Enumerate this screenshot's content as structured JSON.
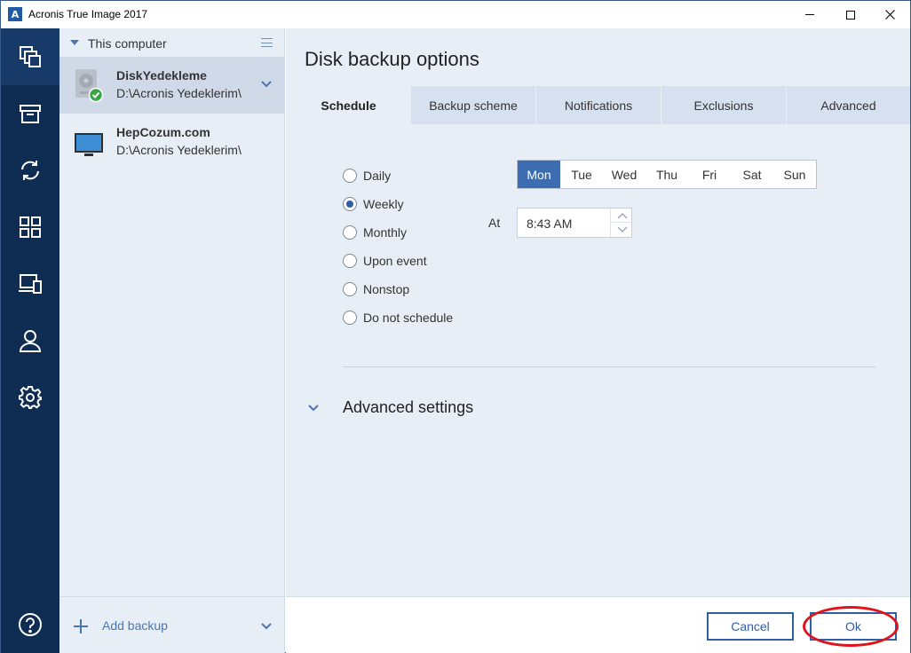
{
  "window": {
    "logo_letter": "A",
    "title": "Acronis True Image 2017"
  },
  "rail": {
    "items": [
      {
        "name": "backup",
        "icon": "backup-copies-icon",
        "active": true
      },
      {
        "name": "archive",
        "icon": "archive-box-icon"
      },
      {
        "name": "sync",
        "icon": "sync-icon"
      },
      {
        "name": "tools",
        "icon": "tools-grid-icon"
      },
      {
        "name": "devices",
        "icon": "devices-icon"
      },
      {
        "name": "account",
        "icon": "account-icon"
      },
      {
        "name": "settings",
        "icon": "gear-icon"
      },
      {
        "name": "help",
        "icon": "help-icon"
      }
    ]
  },
  "backups": {
    "header": "This computer",
    "items": [
      {
        "name": "DiskYedekleme",
        "path": "D:\\Acronis Yedeklerim\\",
        "icon": "disk-ok-icon",
        "selected": true
      },
      {
        "name": "HepCozum.com",
        "path": "D:\\Acronis Yedeklerim\\",
        "icon": "monitor-icon",
        "selected": false
      }
    ],
    "add_label": "Add backup"
  },
  "main": {
    "title": "Disk backup options",
    "tabs": [
      {
        "label": "Schedule",
        "active": true
      },
      {
        "label": "Backup scheme"
      },
      {
        "label": "Notifications"
      },
      {
        "label": "Exclusions"
      },
      {
        "label": "Advanced"
      }
    ],
    "schedule_options": [
      "Daily",
      "Weekly",
      "Monthly",
      "Upon event",
      "Nonstop",
      "Do not schedule"
    ],
    "selected_option": "Weekly",
    "days": [
      "Mon",
      "Tue",
      "Wed",
      "Thu",
      "Fri",
      "Sat",
      "Sun"
    ],
    "selected_day": "Mon",
    "at_label": "At",
    "time_value": "8:43 AM",
    "advanced_settings": "Advanced settings",
    "cancel_label": "Cancel",
    "ok_label": "Ok"
  },
  "colors": {
    "rail": "#0f2c53",
    "accent": "#2e5fa5",
    "highlight": "#e0131b",
    "panel": "#e8eef6"
  }
}
